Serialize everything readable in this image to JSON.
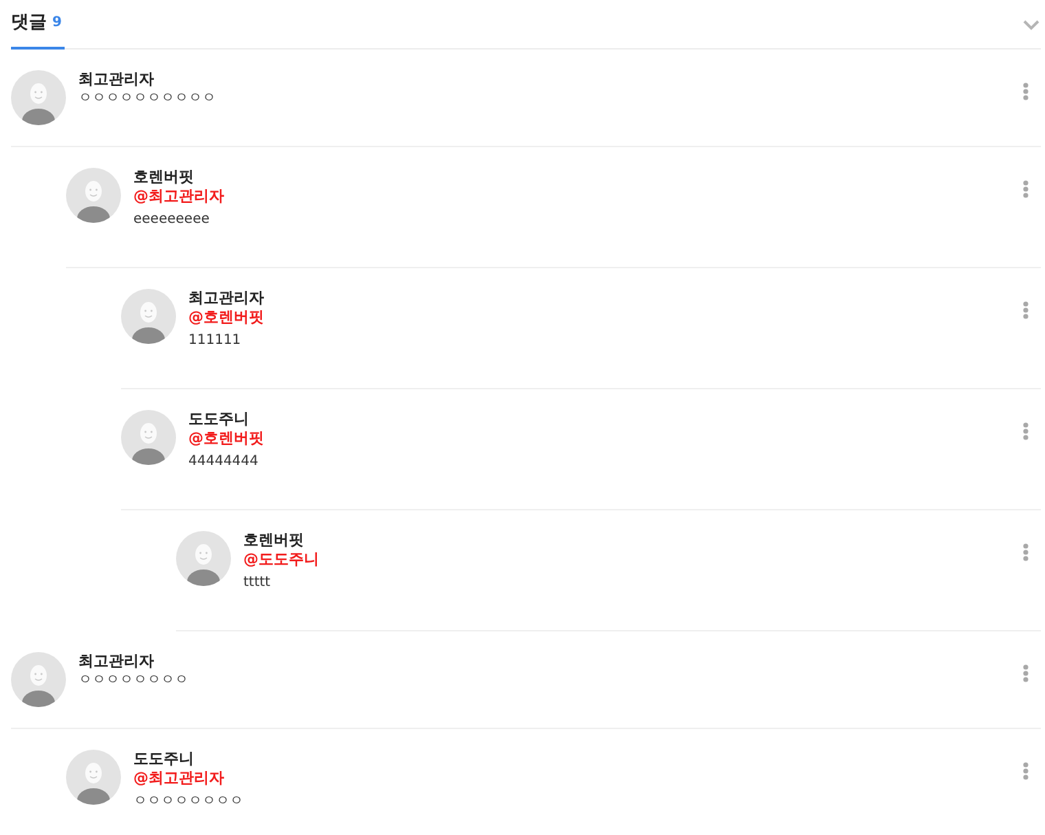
{
  "comments_tab": {
    "label": "댓글",
    "count": "9",
    "selected": true
  },
  "comments": [
    {
      "author": "최고관리자",
      "text": "ㅇㅇㅇㅇㅇㅇㅇㅇㅇㅇ",
      "children": [
        {
          "author": "호렌버핏",
          "mention": "@최고관리자",
          "text": "eeeeeeeee",
          "children": [
            {
              "author": "최고관리자",
              "mention": "@호렌버핏",
              "text": "111111"
            },
            {
              "author": "도도주니",
              "mention": "@호렌버핏",
              "text": "44444444",
              "children": [
                {
                  "author": "호렌버핏",
                  "mention": "@도도주니",
                  "text": "ttttt"
                }
              ]
            }
          ]
        }
      ]
    },
    {
      "author": "최고관리자",
      "text": "ㅇㅇㅇㅇㅇㅇㅇㅇ",
      "children": [
        {
          "author": "도도주니",
          "mention": "@최고관리자",
          "text": "ㅇㅇㅇㅇㅇㅇㅇㅇ"
        }
      ]
    }
  ]
}
